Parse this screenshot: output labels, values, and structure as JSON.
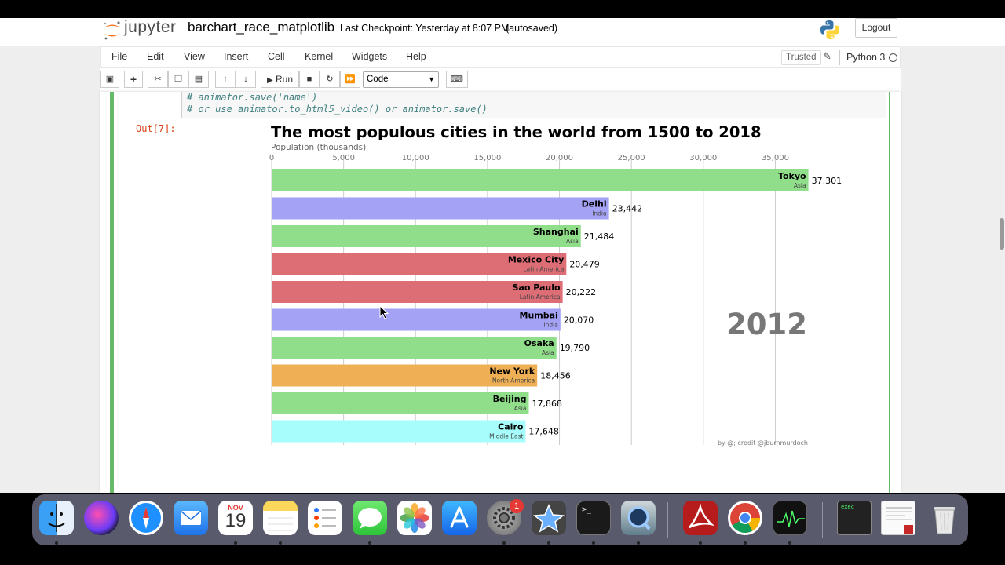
{
  "header": {
    "logo_text": "jupyter",
    "notebook_name": "barchart_race_matplotlib",
    "checkpoint": "Last Checkpoint: Yesterday at 8:07 PM",
    "autosave": "(autosaved)",
    "logout_label": "Logout"
  },
  "menubar": {
    "items": [
      "File",
      "Edit",
      "View",
      "Insert",
      "Cell",
      "Kernel",
      "Widgets",
      "Help"
    ],
    "trusted_label": "Trusted",
    "kernel_name": "Python 3"
  },
  "toolbar": {
    "run_label": "Run",
    "cell_type": "Code"
  },
  "cell": {
    "code_lines": [
      "# animator.save('name')",
      "# or use animator.to_html5_video() or animator.save()"
    ],
    "out_prompt": "Out[7]:"
  },
  "chart_data": {
    "type": "bar",
    "orientation": "horizontal",
    "title": "The most populous cities in the world from 1500 to 2018",
    "xlabel": "Population (thousands)",
    "xticks": [
      0,
      5000,
      10000,
      15000,
      20000,
      25000,
      30000,
      35000
    ],
    "xtick_labels": [
      "0",
      "5,000",
      "10,000",
      "15,000",
      "20,000",
      "25,000",
      "30,000",
      "35,000"
    ],
    "xlim": [
      0,
      39500
    ],
    "year": "2012",
    "credit": "by @; credit @jburnmurdoch",
    "bars": [
      {
        "city": "Tokyo",
        "region": "Asia",
        "value": 37301,
        "value_label": "37,301",
        "color": "#90de8a"
      },
      {
        "city": "Delhi",
        "region": "India",
        "value": 23442,
        "value_label": "23,442",
        "color": "#a4a2f4"
      },
      {
        "city": "Shanghai",
        "region": "Asia",
        "value": 21484,
        "value_label": "21,484",
        "color": "#90de8a"
      },
      {
        "city": "Mexico City",
        "region": "Latin America",
        "value": 20479,
        "value_label": "20,479",
        "color": "#dd6e76"
      },
      {
        "city": "Sao Paulo",
        "region": "Latin America",
        "value": 20222,
        "value_label": "20,222",
        "color": "#dd6e76"
      },
      {
        "city": "Mumbai",
        "region": "India",
        "value": 20070,
        "value_label": "20,070",
        "color": "#a4a2f4"
      },
      {
        "city": "Osaka",
        "region": "Asia",
        "value": 19790,
        "value_label": "19,790",
        "color": "#90de8a"
      },
      {
        "city": "New York",
        "region": "North America",
        "value": 18456,
        "value_label": "18,456",
        "color": "#efb055"
      },
      {
        "city": "Beijing",
        "region": "Asia",
        "value": 17868,
        "value_label": "17,868",
        "color": "#90de8a"
      },
      {
        "city": "Cairo",
        "region": "Middle East",
        "value": 17648,
        "value_label": "17,648",
        "color": "#a6fdfb"
      }
    ]
  },
  "dock": {
    "calendar_month": "NOV",
    "calendar_day": "19",
    "settings_badge": "1",
    "terminal_prompt": ">_",
    "exec_label": "exec"
  }
}
